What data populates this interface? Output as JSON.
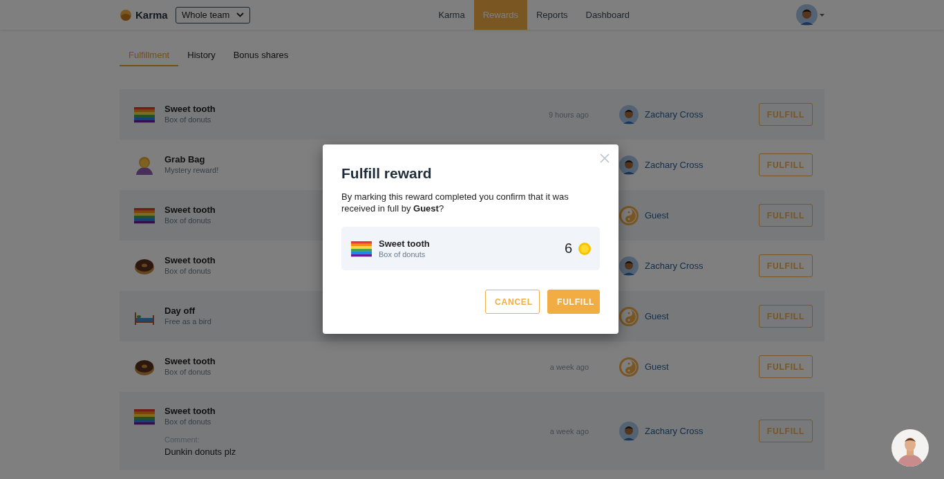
{
  "header": {
    "logo": "Karma",
    "team_select": "Whole team",
    "nav": [
      {
        "label": "Karma",
        "selected": false
      },
      {
        "label": "Rewards",
        "selected": true
      },
      {
        "label": "Reports",
        "selected": false
      },
      {
        "label": "Dashboard",
        "selected": false
      }
    ]
  },
  "tabs": [
    {
      "label": "Fulfillment",
      "selected": true
    },
    {
      "label": "History",
      "selected": false
    },
    {
      "label": "Bonus shares",
      "selected": false
    }
  ],
  "rewards": [
    {
      "kind": "flag",
      "title": "Sweet tooth",
      "subtitle": "Box of donuts",
      "time": "9 hours ago",
      "user": {
        "kind": "person",
        "name": "Zachary Cross"
      },
      "action": "FULFILL"
    },
    {
      "kind": "person",
      "title": "Grab Bag",
      "subtitle": "Mystery reward!",
      "user": {
        "kind": "person",
        "name": "Zachary Cross"
      },
      "action": "FULFILL"
    },
    {
      "kind": "flag",
      "title": "Sweet tooth",
      "subtitle": "Box of donuts",
      "user": {
        "kind": "yinyang",
        "name": "Guest"
      },
      "action": "FULFILL"
    },
    {
      "kind": "donut",
      "title": "Sweet tooth",
      "subtitle": "Box of donuts",
      "user": {
        "kind": "person",
        "name": "Zachary Cross"
      },
      "action": "FULFILL"
    },
    {
      "kind": "bed",
      "title": "Day off",
      "subtitle": "Free as a bird",
      "user": {
        "kind": "yinyang",
        "name": "Guest"
      },
      "action": "FULFILL"
    },
    {
      "kind": "donut",
      "title": "Sweet tooth",
      "subtitle": "Box of donuts",
      "time": "a week ago",
      "user": {
        "kind": "yinyang",
        "name": "Guest"
      },
      "action": "FULFILL"
    },
    {
      "kind": "flag",
      "title": "Sweet tooth",
      "subtitle": "Box of donuts",
      "comment_label": "Comment:",
      "comment": "Dunkin donuts plz",
      "time": "a week ago",
      "user": {
        "kind": "person",
        "name": "Zachary Cross"
      },
      "action": "FULFILL"
    }
  ],
  "modal": {
    "title": "Fulfill reward",
    "message": "By marking this reward completed you confirm that it was received in full by **Guest**?",
    "item": {
      "kind": "flag",
      "title": "Sweet tooth",
      "subtitle": "Box of donuts",
      "cost": "6"
    },
    "buttons": [
      {
        "label": "CANCEL",
        "kind": "secondary"
      },
      {
        "label": "FULFILL",
        "kind": "primary"
      }
    ]
  }
}
